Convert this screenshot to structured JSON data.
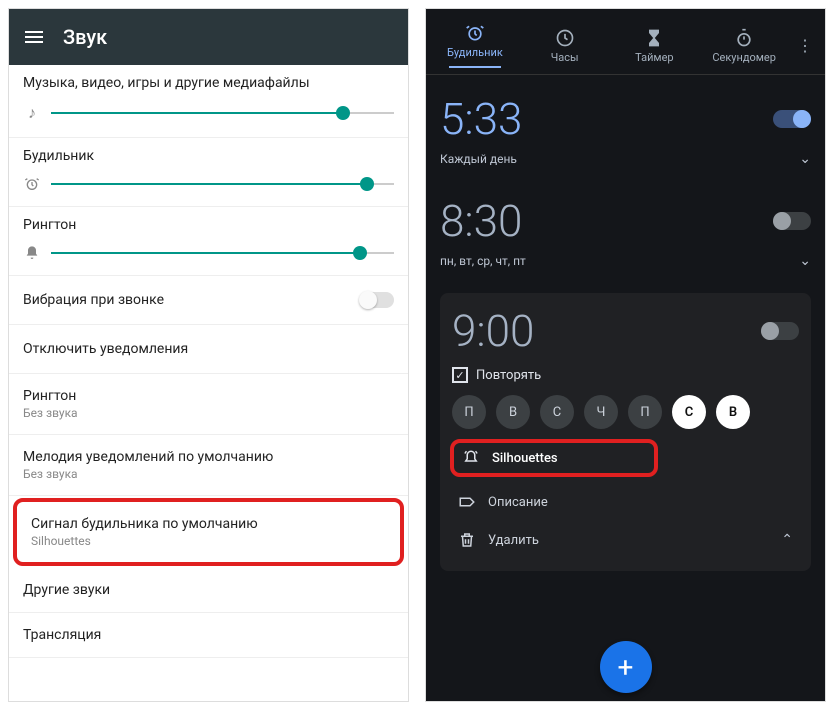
{
  "left": {
    "title": "Звук",
    "sliders": [
      {
        "label": "Музыка, видео, игры и другие медиафайлы",
        "icon": "music-note",
        "value": 85
      },
      {
        "label": "Будильник",
        "icon": "alarm",
        "value": 92
      },
      {
        "label": "Рингтон",
        "icon": "bell",
        "value": 90
      }
    ],
    "vibration_label": "Вибрация при звонке",
    "dnd_label": "Отключить уведомления",
    "ringtone": {
      "title": "Рингтон",
      "sub": "Без звука"
    },
    "notification": {
      "title": "Мелодия уведомлений по умолчанию",
      "sub": "Без звука"
    },
    "alarm_signal": {
      "title": "Сигнал будильника по умолчанию",
      "sub": "Silhouettes"
    },
    "other_sounds": "Другие звуки",
    "casting": "Трансляция"
  },
  "right": {
    "tabs": [
      {
        "label": "Будильник",
        "icon": "alarm",
        "active": true
      },
      {
        "label": "Часы",
        "icon": "clock"
      },
      {
        "label": "Таймер",
        "icon": "hourglass"
      },
      {
        "label": "Секундомер",
        "icon": "stopwatch"
      }
    ],
    "alarms": [
      {
        "time": "5:33",
        "schedule": "Каждый день",
        "on": true
      },
      {
        "time": "8:30",
        "schedule": "пн, вт, ср, чт, пт",
        "on": false
      }
    ],
    "expanded": {
      "time": "9:00",
      "on": false,
      "repeat_label": "Повторять",
      "days": [
        "П",
        "В",
        "С",
        "Ч",
        "П",
        "С",
        "В"
      ],
      "days_on": [
        false,
        false,
        false,
        false,
        false,
        true,
        true
      ],
      "ringtone": "Silhouettes",
      "description_label": "Описание",
      "delete_label": "Удалить"
    }
  }
}
